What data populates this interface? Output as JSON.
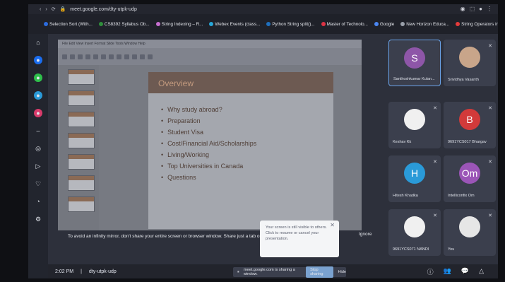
{
  "browser": {
    "url": "meet.google.com/dty-utpk-udp",
    "bookmarks": [
      {
        "label": "Selection Sort (With...",
        "color": "#2d6cdf"
      },
      {
        "label": "CS8392 Syllabus Ob...",
        "color": "#2f8f3b"
      },
      {
        "label": "String Indexing – R...",
        "color": "#c76fd0"
      },
      {
        "label": "Webex Events (class...",
        "color": "#27a7d8"
      },
      {
        "label": "Python String split()...",
        "color": "#1f6fbd"
      },
      {
        "label": "Master of Technolo...",
        "color": "#d34"
      },
      {
        "label": "Google",
        "color": "#4b86f2"
      },
      {
        "label": "New Horizon Educa...",
        "color": "#9aa0aa"
      },
      {
        "label": "String Operators in...",
        "color": "#e53b3b"
      }
    ]
  },
  "slide": {
    "title": "Overview",
    "bullets": [
      "Why study abroad?",
      "Preparation",
      "Student Visa",
      "Cost/Financial Aid/Scholarships",
      "Living/Working",
      "Top Universities in Canada",
      "Questions"
    ]
  },
  "warning": {
    "text": "To avoid an infinity mirror, don't share your entire screen or browser window. Share just a tab or a different window instead.",
    "ignore_label": "Ignore"
  },
  "popup": {
    "text": "Your screen is still visible to others. Click to resume or cancel your presentation."
  },
  "participants": [
    {
      "name": "Santhoshkumar Kulan...",
      "initial": "S",
      "color": "#8e56a8"
    },
    {
      "name": "Srividhya Vasanth",
      "initial": "",
      "color": "#c8a58a"
    },
    {
      "name": "Keshav Kk",
      "initial": "",
      "color": "#f0f0f0"
    },
    {
      "name": "9691YCS017 Bhargav",
      "initial": "B",
      "color": "#d23a3a"
    },
    {
      "name": "Hitesh Khadka",
      "initial": "H",
      "color": "#2a9ad8"
    },
    {
      "name": "Intelliconfix Om",
      "initial": "Om",
      "color": "#9b55b7"
    },
    {
      "name": "9691YCS071 NANDI",
      "initial": "",
      "color": "#f0f0f0"
    },
    {
      "name": "You",
      "initial": "",
      "color": "#e6e6e6"
    }
  ],
  "bottom": {
    "time": "2:02 PM",
    "meeting_code": "dty-utpk-udp",
    "share_text": "meet.google.com is sharing a window.",
    "stop_label": "Stop sharing",
    "hide_label": "Hide"
  }
}
